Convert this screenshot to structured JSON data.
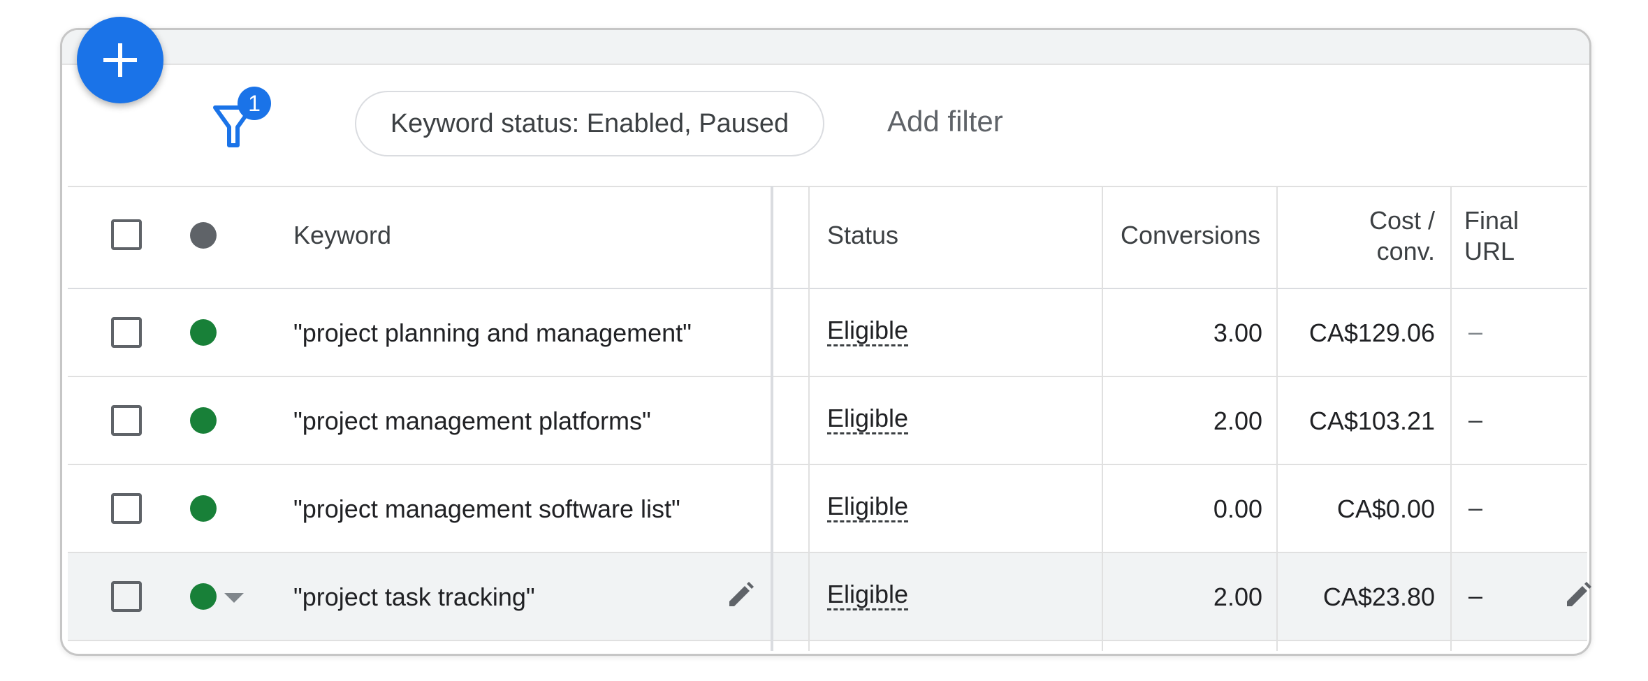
{
  "toolbar": {
    "fab_icon": "plus-icon",
    "filter_icon": "filter-icon",
    "filter_count": "1",
    "filter_chip": "Keyword status: Enabled, Paused",
    "add_filter": "Add filter"
  },
  "table": {
    "headers": {
      "keyword": "Keyword",
      "status": "Status",
      "conversions": "Conversions",
      "cost_conv_line1": "Cost /",
      "cost_conv_line2": "conv.",
      "final_url_line1": "Final",
      "final_url_line2": "URL"
    },
    "rows": [
      {
        "keyword": "\"project planning and management\"",
        "status": "Eligible",
        "conversions": "3.00",
        "cost_conv": "CA$129.06",
        "final_url": "–"
      },
      {
        "keyword": "\"project management platforms\"",
        "status": "Eligible",
        "conversions": "2.00",
        "cost_conv": "CA$103.21",
        "final_url": "–"
      },
      {
        "keyword": "\"project management software list\"",
        "status": "Eligible",
        "conversions": "0.00",
        "cost_conv": "CA$0.00",
        "final_url": "–"
      },
      {
        "keyword": "\"project task tracking\"",
        "status": "Eligible",
        "conversions": "2.00",
        "cost_conv": "CA$23.80",
        "final_url": "–"
      }
    ]
  },
  "colors": {
    "accent": "#1a73e8",
    "enabled_dot": "#188038",
    "header_dot": "#5f6368",
    "hover_row": "#f1f3f4"
  }
}
